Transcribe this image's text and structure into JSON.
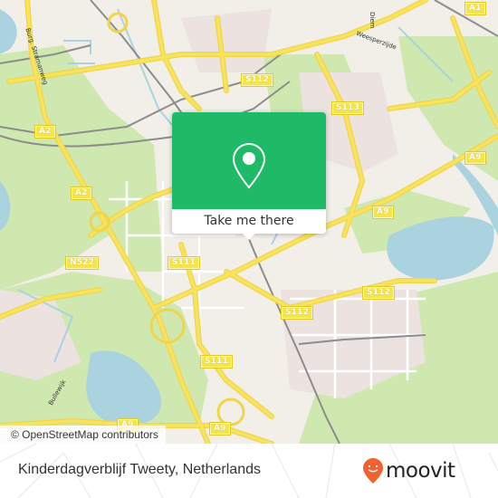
{
  "map": {
    "road_shields": [
      {
        "id": "a1",
        "label": "A1"
      },
      {
        "id": "s112-top",
        "label": "S112"
      },
      {
        "id": "s113",
        "label": "S113"
      },
      {
        "id": "a2-top",
        "label": "A2"
      },
      {
        "id": "a2-mid",
        "label": "A2"
      },
      {
        "id": "a9-right",
        "label": "A9"
      },
      {
        "id": "a9-center",
        "label": "A9"
      },
      {
        "id": "n522",
        "label": "N522"
      },
      {
        "id": "s111-top",
        "label": "S111"
      },
      {
        "id": "s112-right",
        "label": "S112"
      },
      {
        "id": "s112-center",
        "label": "S112"
      },
      {
        "id": "s111-bottom",
        "label": "S111"
      },
      {
        "id": "a9-bottom-left",
        "label": "A9"
      },
      {
        "id": "a9-bottom",
        "label": "A9"
      }
    ],
    "street_labels": {
      "top_left": "Burg. Stramanweg",
      "top_right_1": "Diem",
      "top_right_2": "Weesperzijde",
      "bottom_left": "Bullewijk"
    },
    "attribution": "© OpenStreetMap contributors",
    "colors": {
      "land": "#f2efe9",
      "park": "#c8e6a8",
      "water": "#aad3df",
      "road_major": "#f7e45c",
      "rail": "#8c8c8c"
    }
  },
  "popup": {
    "button_label": "Take me there",
    "accent_color": "#1fba67"
  },
  "footer": {
    "place_name": "Kinderdagverblijf Tweety, Netherlands",
    "brand": "moovit",
    "brand_color": "#f26130"
  }
}
